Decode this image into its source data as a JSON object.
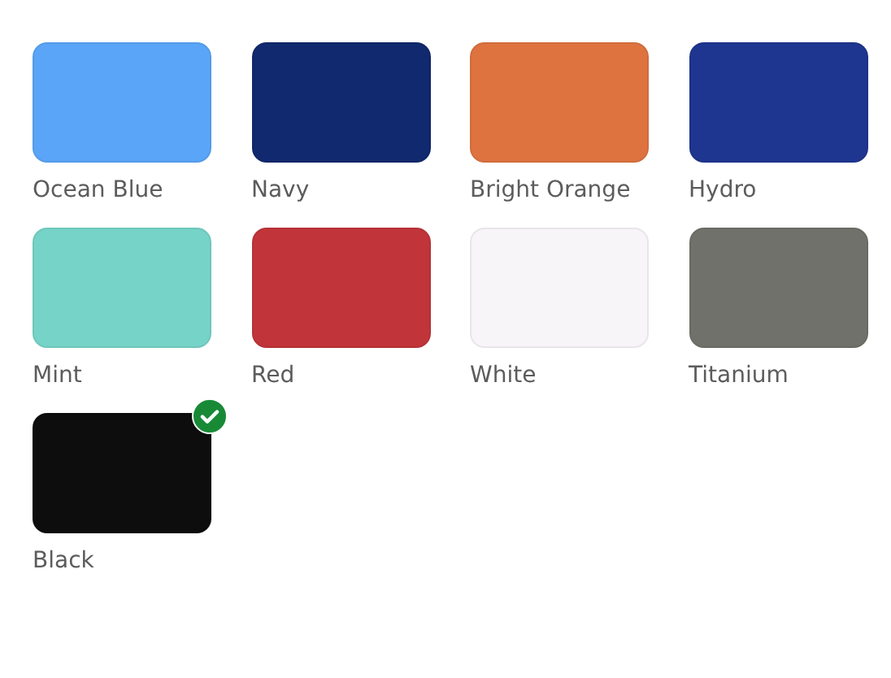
{
  "swatches": [
    {
      "name": "Ocean Blue",
      "color": "#5aa5f7",
      "selected": false
    },
    {
      "name": "Navy",
      "color": "#11296e",
      "selected": false
    },
    {
      "name": "Bright Orange",
      "color": "#de7340",
      "selected": false
    },
    {
      "name": "Hydro",
      "color": "#1f3690",
      "selected": false
    },
    {
      "name": "Mint",
      "color": "#76d3c7",
      "selected": false
    },
    {
      "name": "Red",
      "color": "#c1353a",
      "selected": false
    },
    {
      "name": "White",
      "color": "#f7f5f7",
      "selected": false
    },
    {
      "name": "Titanium",
      "color": "#71716b",
      "selected": false
    },
    {
      "name": "Black",
      "color": "#0d0d0d",
      "selected": true
    }
  ]
}
